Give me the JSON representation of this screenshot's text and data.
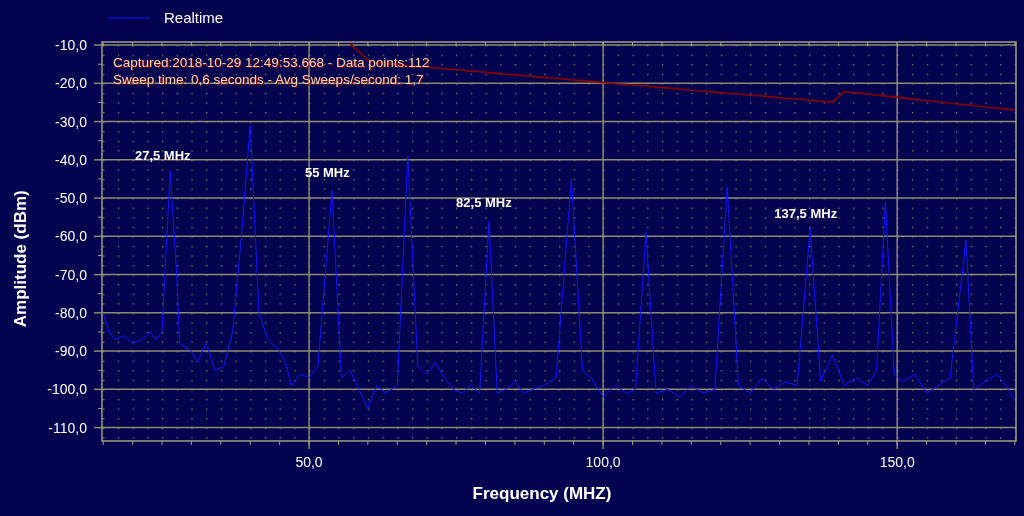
{
  "chart": {
    "info_lines": [
      "Captured:2018-10-29 12:49:53.668 - Data points:112",
      "Sweep time: 0,6 seconds - Avg Sweeps/second: 1,7"
    ],
    "chart_data": {
      "type": "line",
      "xlabel": "Frequency (MHZ)",
      "ylabel": "Amplitude (dBm)",
      "x": [
        15,
        16,
        17,
        18.5,
        20,
        21.5,
        23,
        24,
        25,
        26.4,
        27.5,
        28,
        30,
        31,
        32.5,
        34,
        35.5,
        37,
        38.5,
        40,
        41.5,
        43,
        45,
        46,
        47,
        48.5,
        50,
        51.5,
        53.9,
        55.5,
        57,
        58.5,
        60,
        61.5,
        63,
        65,
        66.8,
        68.5,
        70,
        71.5,
        73,
        74.5,
        76,
        77.5,
        79,
        80.6,
        82,
        83.5,
        85,
        86.5,
        88,
        90,
        92,
        94.6,
        96.5,
        98,
        100,
        102,
        104,
        105.5,
        107.3,
        109,
        111,
        113,
        115,
        117,
        119,
        121.1,
        123,
        125,
        127,
        129,
        131,
        133,
        135.2,
        137,
        139,
        141,
        143,
        145,
        146.5,
        148,
        149.5,
        151,
        153,
        155,
        157,
        159,
        161.7,
        163,
        165,
        167,
        168.5,
        170
      ],
      "series": [
        {
          "name": "Realtime",
          "color": "#1414ff",
          "values": [
            -80,
            -85,
            -87,
            -86,
            -88,
            -87,
            -85,
            -87,
            -85,
            -43,
            -70,
            -88,
            -90,
            -93,
            -88,
            -95,
            -94,
            -85,
            -60,
            -31,
            -80,
            -87,
            -90,
            -93,
            -99,
            -96,
            -97,
            -94,
            -48,
            -97,
            -95,
            -100,
            -105,
            -99,
            -101,
            -99,
            -39,
            -94,
            -96,
            -93,
            -97,
            -100,
            -101,
            -99,
            -101,
            -56,
            -101,
            -100,
            -98,
            -101,
            -100,
            -99,
            -97,
            -45,
            -95,
            -97,
            -102,
            -99,
            -101,
            -100,
            -59,
            -101,
            -100,
            -102,
            -99,
            -101,
            -100,
            -47,
            -99,
            -101,
            -97,
            -100,
            -98,
            -99,
            -58,
            -98,
            -91,
            -99,
            -97,
            -99,
            -95,
            -51,
            -96,
            -98,
            -96,
            -101,
            -99,
            -97,
            -61,
            -100,
            -98,
            -96,
            -99,
            -103
          ]
        },
        {
          "color": "#8b0000",
          "values": [
            null,
            null,
            null,
            null,
            null,
            null,
            null,
            null,
            null,
            null,
            null,
            null,
            null,
            null,
            null,
            null,
            null,
            null,
            null,
            null,
            null,
            null,
            null,
            null,
            null,
            null,
            null,
            null,
            null,
            null,
            -9.7,
            -11.8,
            -13.9,
            -14.6,
            -14.8,
            -15.1,
            -15.4,
            -15.6,
            -15.8,
            -16.0,
            -16.2,
            -16.4,
            -16.6,
            -16.8,
            -17.0,
            -17.2,
            -17.4,
            -17.6,
            -17.8,
            -18.0,
            -18.2,
            -18.5,
            -18.7,
            -19.1,
            -19.3,
            -19.5,
            -19.8,
            -20.1,
            -20.3,
            -20.5,
            -20.7,
            -21.0,
            -21.2,
            -21.5,
            -21.8,
            -22.0,
            -22.3,
            -22.6,
            -22.8,
            -23.1,
            -23.3,
            -23.6,
            -23.9,
            -24.1,
            -24.4,
            -24.7,
            -24.9,
            -22.2,
            -22.5,
            -22.8,
            -23.1,
            -23.3,
            -23.6,
            -23.8,
            -24.2,
            -24.5,
            -24.8,
            -25.2,
            -25.6,
            -25.8,
            -26.2,
            -26.5,
            -26.7,
            -27.0
          ]
        }
      ],
      "xlim": [
        14.8,
        170.2
      ],
      "ylim": [
        -113.5,
        -9.2
      ],
      "xticks": [
        {
          "value": 50,
          "label": "50,0"
        },
        {
          "value": 100,
          "label": "100,0"
        },
        {
          "value": 150,
          "label": "150,0"
        }
      ],
      "yticks": [
        {
          "value": -10,
          "label": "-10,0"
        },
        {
          "value": -20,
          "label": "-20,0"
        },
        {
          "value": -30,
          "label": "-30,0"
        },
        {
          "value": -40,
          "label": "-40,0"
        },
        {
          "value": -50,
          "label": "-50,0"
        },
        {
          "value": -60,
          "label": "-60,0"
        },
        {
          "value": -70,
          "label": "-70,0"
        },
        {
          "value": -80,
          "label": "-80,0"
        },
        {
          "value": -90,
          "label": "-90,0"
        },
        {
          "value": -100,
          "label": "-100,0"
        },
        {
          "value": -110,
          "label": "-110,0"
        }
      ],
      "grid": true,
      "annotations": [
        "27,5 MHz",
        "55 MHz",
        "82,5 MHz",
        "137,5 MHz"
      ]
    }
  }
}
